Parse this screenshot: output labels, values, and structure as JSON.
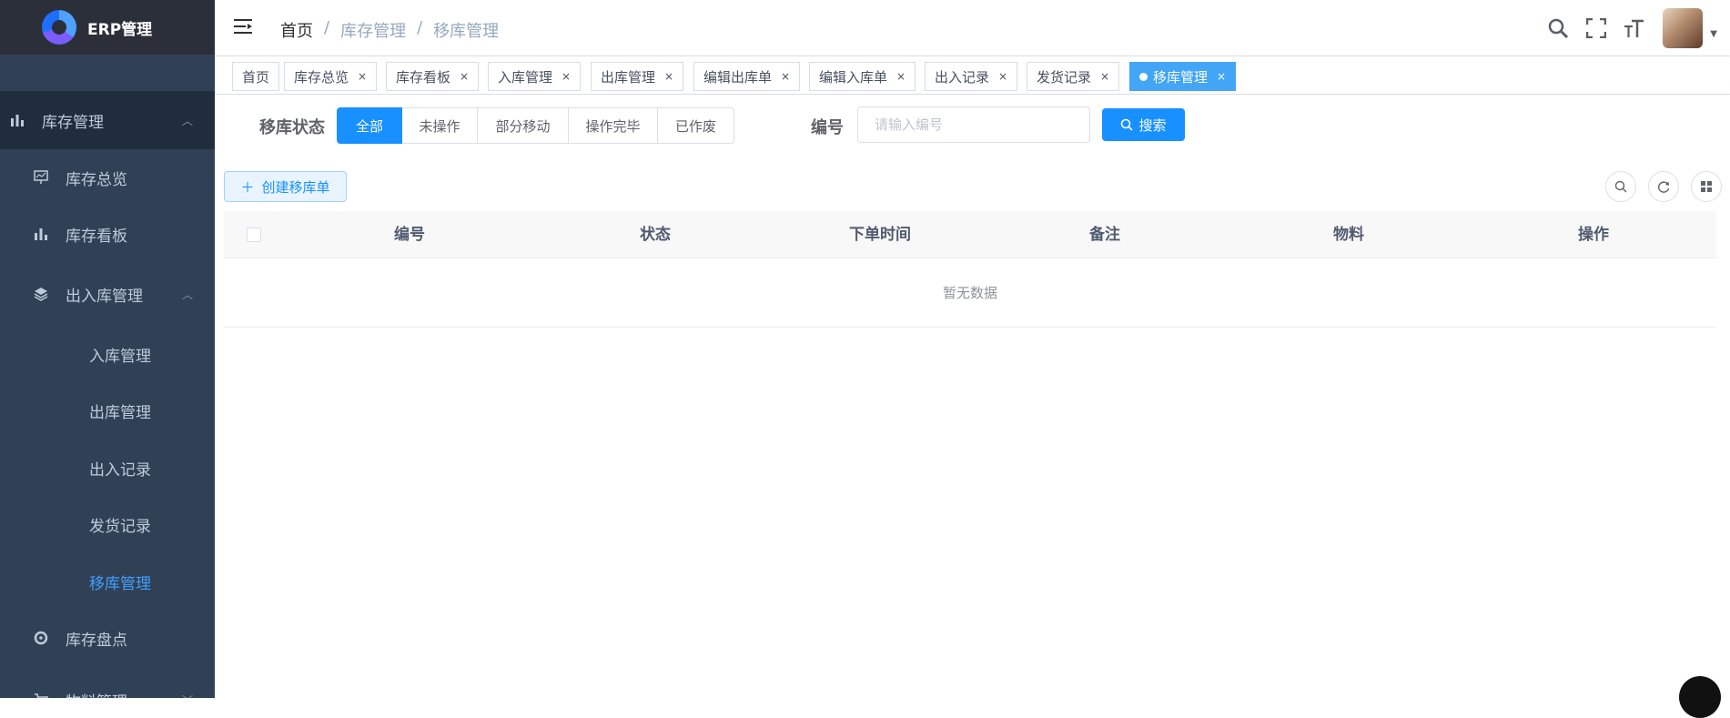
{
  "app": {
    "title": "ERP管理"
  },
  "sidebar": {
    "items": [
      {
        "label": "库存管理",
        "arrow": "︿"
      },
      {
        "label": "库存总览"
      },
      {
        "label": "库存看板"
      },
      {
        "label": "出入库管理",
        "arrow": "︿"
      },
      {
        "label": "入库管理"
      },
      {
        "label": "出库管理"
      },
      {
        "label": "出入记录"
      },
      {
        "label": "发货记录"
      },
      {
        "label": "移库管理"
      },
      {
        "label": "库存盘点"
      },
      {
        "label": "物料管理",
        "arrow": "﹀"
      }
    ]
  },
  "header": {
    "breadcrumb": [
      "首页",
      "/",
      "库存管理",
      "/",
      "移库管理"
    ]
  },
  "tags": [
    {
      "label": "首页",
      "closable": false
    },
    {
      "label": "库存总览",
      "close": "×"
    },
    {
      "label": "库存看板",
      "close": "×"
    },
    {
      "label": "入库管理",
      "close": "×"
    },
    {
      "label": "出库管理",
      "close": "×"
    },
    {
      "label": "编辑出库单",
      "close": "×"
    },
    {
      "label": "编辑入库单",
      "close": "×"
    },
    {
      "label": "出入记录",
      "close": "×"
    },
    {
      "label": "发货记录",
      "close": "×"
    },
    {
      "label": "移库管理",
      "close": "×",
      "active": true
    }
  ],
  "filter": {
    "status_label": "移库状态",
    "status_options": [
      "全部",
      "未操作",
      "部分移动",
      "操作完毕",
      "已作废"
    ],
    "selected": "全部",
    "code_label": "编号",
    "code_placeholder": "请输入编号",
    "search_label": "搜索"
  },
  "toolbar": {
    "create_label": "创建移库单"
  },
  "table": {
    "columns": [
      "编号",
      "状态",
      "下单时间",
      "备注",
      "物料",
      "操作"
    ],
    "empty_text": "暂无数据"
  },
  "colors": {
    "primary": "#1890ff",
    "sidebar_bg": "#304156",
    "active_tag": "#42a5f5"
  }
}
